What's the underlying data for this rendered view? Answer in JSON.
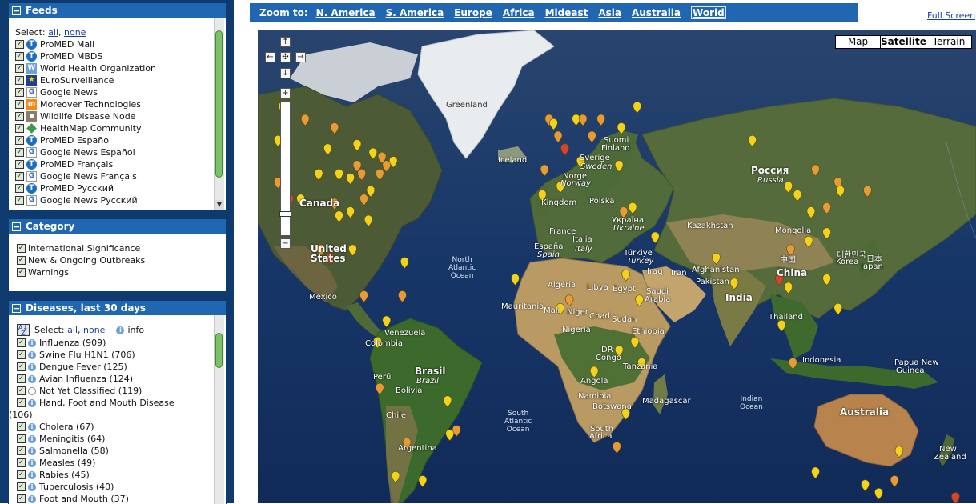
{
  "feeds_panel": {
    "title": "Feeds",
    "select_label": "Select:",
    "select_all": "all",
    "select_none": "none",
    "items": [
      {
        "label": "ProMED Mail",
        "icon": "promed-icon"
      },
      {
        "label": "ProMED MBDS",
        "icon": "promed-icon"
      },
      {
        "label": "World Health Organization",
        "icon": "who-icon"
      },
      {
        "label": "EuroSurveillance",
        "icon": "eurosurveillance-icon"
      },
      {
        "label": "Google News",
        "icon": "google-icon"
      },
      {
        "label": "Moreover Technologies",
        "icon": "moreover-icon"
      },
      {
        "label": "Wildlife Disease Node",
        "icon": "wildlife-icon"
      },
      {
        "label": "HealthMap Community",
        "icon": "healthmap-icon"
      },
      {
        "label": "ProMED Español",
        "icon": "promed-icon"
      },
      {
        "label": "Google News Español",
        "icon": "google-icon"
      },
      {
        "label": "ProMED Français",
        "icon": "promed-icon"
      },
      {
        "label": "Google News Français",
        "icon": "google-icon"
      },
      {
        "label": "ProMED Русский",
        "icon": "promed-icon"
      },
      {
        "label": "Google News Русский",
        "icon": "google-icon"
      }
    ]
  },
  "category_panel": {
    "title": "Category",
    "items": [
      "International Significance",
      "New & Ongoing Outbreaks",
      "Warnings"
    ]
  },
  "diseases_panel": {
    "title": "Diseases, last 30 days",
    "select_label": "Select:",
    "select_all": "all",
    "select_none": "none",
    "info_label": "info",
    "items": [
      {
        "label": "Influenza (909)"
      },
      {
        "label": "Swine Flu H1N1 (706)"
      },
      {
        "label": "Dengue Fever (125)"
      },
      {
        "label": "Avian Influenza (124)"
      },
      {
        "label": "Not Yet Classified (119)",
        "empty_info": true
      },
      {
        "label": "Hand, Foot and Mouth Disease",
        "wrap": "(106)"
      },
      {
        "label": "Cholera (67)"
      },
      {
        "label": "Meningitis (64)"
      },
      {
        "label": "Salmonella (58)"
      },
      {
        "label": "Measles (49)"
      },
      {
        "label": "Rabies (45)"
      },
      {
        "label": "Tuberculosis (40)"
      },
      {
        "label": "Foot and Mouth (37)"
      }
    ]
  },
  "zoombar": {
    "label": "Zoom to:",
    "links": [
      "N. America",
      "S. America",
      "Europe",
      "Africa",
      "Mideast",
      "Asia",
      "Australia",
      "World"
    ],
    "active": "World"
  },
  "fullscreen_label": "Full Screen",
  "map_types": [
    "Map",
    "Satellite",
    "Terrain"
  ],
  "map_type_active": "Satellite",
  "map_controls": {
    "up": "↑",
    "left": "←",
    "center": "✣",
    "right": "→",
    "down": "↓",
    "zoom_in": "+",
    "zoom_out": "−"
  },
  "colors": {
    "header_blue": "#2166b1",
    "sidebar_navy": "#0e3a6d",
    "ocean": "#173668",
    "marker_yellow": "#f2d21a",
    "marker_orange": "#e79b37",
    "marker_red": "#d9432c"
  },
  "map_labels": {
    "greenland": "Greenland",
    "iceland": "Iceland",
    "suomi": "Suomi",
    "finland": "Finland",
    "sverige": "Sverige",
    "sweden": "Sweden",
    "norge": "Norge",
    "norway": "Norway",
    "russia_native": "Россия",
    "russia": "Russia",
    "canada": "Canada",
    "united": "United",
    "states": "States",
    "mexico": "México",
    "kingdom": "Kingdom",
    "polska": "Polska",
    "ukraina": "Україна",
    "ukraine": "Ukraine",
    "france": "France",
    "espana": "España",
    "spain": "Spain",
    "italia": "Italia",
    "italy": "Italy",
    "turkiye": "Türkiye",
    "turkey": "Turkey",
    "iraq": "Iraq",
    "iran": "Iran",
    "kazakhstan": "Kazakhstan",
    "mongolia": "Mongolia",
    "afghanistan": "Afghanistan",
    "pakistan": "Pakistan",
    "korea_native": "대한민국",
    "korea": "Korea",
    "japan_native": "日本",
    "japan": "Japan",
    "china_native": "中国",
    "china": "China",
    "india": "India",
    "thailand": "Thailand",
    "indonesia": "Indonesia",
    "papua": "Papua New",
    "guinea": "Guinea",
    "australia": "Australia",
    "new": "New",
    "zealand": "Zealand",
    "algeria": "Algeria",
    "libya": "Libya",
    "egypt": "Egypt",
    "saudi": "Saudi",
    "arabia": "Arabia",
    "mauritania": "Mauritania",
    "mali": "Mali",
    "niger": "Niger",
    "chad": "Chad",
    "sudan": "Sudan",
    "nigeria": "Nigeria",
    "ethiopia": "Ethiopia",
    "dr": "DR",
    "congo": "Congo",
    "tanzania": "Tanzania",
    "angola": "Angola",
    "namibia": "Namibia",
    "botswana": "Botswana",
    "south": "South",
    "africa": "Africa",
    "madagascar": "Madagascar",
    "venezuela": "Venezuela",
    "colombia": "Colombia",
    "peru": "Perú",
    "brasil": "Brasil",
    "brazil": "Brazil",
    "bolivia": "Bolivia",
    "chile": "Chile",
    "argentina": "Argentina",
    "north_atlantic": "North\nAtlantic\nOcean",
    "south_atlantic": "South\nAtlantic\nOcean",
    "indian_ocean": "Indian\nOcean"
  },
  "markers": [
    {
      "lon": -120,
      "lat": 55,
      "c": "y"
    },
    {
      "lon": -110,
      "lat": 52,
      "c": "o"
    },
    {
      "lon": -97,
      "lat": 50,
      "c": "o"
    },
    {
      "lon": -87,
      "lat": 46,
      "c": "y"
    },
    {
      "lon": -80,
      "lat": 44,
      "c": "y"
    },
    {
      "lon": -76,
      "lat": 43,
      "c": "o"
    },
    {
      "lon": -74,
      "lat": 41,
      "c": "o"
    },
    {
      "lon": -71,
      "lat": 42,
      "c": "y"
    },
    {
      "lon": -77,
      "lat": 39,
      "c": "o"
    },
    {
      "lon": -81,
      "lat": 35,
      "c": "y"
    },
    {
      "lon": -84,
      "lat": 33,
      "c": "o"
    },
    {
      "lon": -87,
      "lat": 41,
      "c": "o"
    },
    {
      "lon": -90,
      "lat": 38,
      "c": "y"
    },
    {
      "lon": -95,
      "lat": 39,
      "c": "y"
    },
    {
      "lon": -97,
      "lat": 32,
      "c": "o"
    },
    {
      "lon": -95,
      "lat": 29,
      "c": "y"
    },
    {
      "lon": -104,
      "lat": 39,
      "c": "y"
    },
    {
      "lon": -112,
      "lat": 33,
      "c": "y"
    },
    {
      "lon": -118,
      "lat": 34,
      "c": "o"
    },
    {
      "lon": -122,
      "lat": 37,
      "c": "o"
    },
    {
      "lon": -122,
      "lat": 47,
      "c": "y"
    },
    {
      "lon": -117,
      "lat": 33,
      "c": "r"
    },
    {
      "lon": -82,
      "lat": 28,
      "c": "y"
    },
    {
      "lon": -90,
      "lat": 30,
      "c": "y"
    },
    {
      "lon": -85,
      "lat": 39,
      "c": "o"
    },
    {
      "lon": -100,
      "lat": 45,
      "c": "y"
    },
    {
      "lon": -99,
      "lat": 19,
      "c": "r"
    },
    {
      "lon": -103,
      "lat": 21,
      "c": "o"
    },
    {
      "lon": -89,
      "lat": 21,
      "c": "y"
    },
    {
      "lon": -84,
      "lat": 10,
      "c": "o"
    },
    {
      "lon": -66,
      "lat": 18,
      "c": "y"
    },
    {
      "lon": -67,
      "lat": 10,
      "c": "o"
    },
    {
      "lon": -74,
      "lat": 4,
      "c": "y"
    },
    {
      "lon": -78,
      "lat": -1,
      "c": "y"
    },
    {
      "lon": -77,
      "lat": -12,
      "c": "o"
    },
    {
      "lon": -47,
      "lat": -15,
      "c": "y"
    },
    {
      "lon": -43,
      "lat": -22,
      "c": "o"
    },
    {
      "lon": -46,
      "lat": -23,
      "c": "y"
    },
    {
      "lon": -58,
      "lat": -34,
      "c": "y"
    },
    {
      "lon": -70,
      "lat": -33,
      "c": "y"
    },
    {
      "lon": -65,
      "lat": -25,
      "c": "o"
    },
    {
      "lon": -2,
      "lat": 52,
      "c": "o"
    },
    {
      "lon": 0,
      "lat": 51,
      "c": "y"
    },
    {
      "lon": 2,
      "lat": 48,
      "c": "o"
    },
    {
      "lon": -4,
      "lat": 40,
      "c": "o"
    },
    {
      "lon": 10,
      "lat": 52,
      "c": "y"
    },
    {
      "lon": 13,
      "lat": 52,
      "c": "o"
    },
    {
      "lon": 12,
      "lat": 42,
      "c": "y"
    },
    {
      "lon": 21,
      "lat": 52,
      "c": "o"
    },
    {
      "lon": 30,
      "lat": 50,
      "c": "y"
    },
    {
      "lon": 37,
      "lat": 55,
      "c": "y"
    },
    {
      "lon": 29,
      "lat": 41,
      "c": "y"
    },
    {
      "lon": 35,
      "lat": 31,
      "c": "y"
    },
    {
      "lon": 31,
      "lat": 30,
      "c": "o"
    },
    {
      "lon": 5,
      "lat": 45,
      "c": "r"
    },
    {
      "lon": 17,
      "lat": 48,
      "c": "o"
    },
    {
      "lon": 3,
      "lat": 36,
      "c": "y"
    },
    {
      "lon": -5,
      "lat": 34,
      "c": "y"
    },
    {
      "lon": -17,
      "lat": 14,
      "c": "y"
    },
    {
      "lon": 3,
      "lat": 7,
      "c": "y"
    },
    {
      "lon": 7,
      "lat": 9,
      "c": "o"
    },
    {
      "lon": 32,
      "lat": 15,
      "c": "y"
    },
    {
      "lon": 38,
      "lat": 9,
      "c": "y"
    },
    {
      "lon": 36,
      "lat": -1,
      "c": "y"
    },
    {
      "lon": 29,
      "lat": -3,
      "c": "y"
    },
    {
      "lon": 39,
      "lat": -6,
      "c": "y"
    },
    {
      "lon": 18,
      "lat": -8,
      "c": "y"
    },
    {
      "lon": 28,
      "lat": -26,
      "c": "o"
    },
    {
      "lon": 32,
      "lat": -18,
      "c": "y"
    },
    {
      "lon": 45,
      "lat": 24,
      "c": "y"
    },
    {
      "lon": 88,
      "lat": 47,
      "c": "y"
    },
    {
      "lon": 104,
      "lat": 36,
      "c": "y"
    },
    {
      "lon": 113,
      "lat": 23,
      "c": "y"
    },
    {
      "lon": 116,
      "lat": 40,
      "c": "o"
    },
    {
      "lon": 121,
      "lat": 31,
      "c": "o"
    },
    {
      "lon": 114,
      "lat": 30,
      "c": "y"
    },
    {
      "lon": 108,
      "lat": 34,
      "c": "y"
    },
    {
      "lon": 126,
      "lat": 37,
      "c": "o"
    },
    {
      "lon": 127,
      "lat": 35,
      "c": "y"
    },
    {
      "lon": 121,
      "lat": 25,
      "c": "y"
    },
    {
      "lon": 139,
      "lat": 35,
      "c": "o"
    },
    {
      "lon": 100,
      "lat": 14,
      "c": "r"
    },
    {
      "lon": 105,
      "lat": 21,
      "c": "o"
    },
    {
      "lon": 101,
      "lat": 3,
      "c": "y"
    },
    {
      "lon": 106,
      "lat": -6,
      "c": "o"
    },
    {
      "lon": 121,
      "lat": 14,
      "c": "y"
    },
    {
      "lon": 104,
      "lat": 12,
      "c": "y"
    },
    {
      "lon": 80,
      "lat": 13,
      "c": "y"
    },
    {
      "lon": 72,
      "lat": 19,
      "c": "y"
    },
    {
      "lon": 126,
      "lat": 7,
      "c": "y"
    },
    {
      "lon": 144,
      "lat": -37,
      "c": "y"
    },
    {
      "lon": 151,
      "lat": -34,
      "c": "o"
    },
    {
      "lon": 153,
      "lat": -27,
      "c": "y"
    },
    {
      "lon": 116,
      "lat": -32,
      "c": "y"
    },
    {
      "lon": 138,
      "lat": -35,
      "c": "y"
    },
    {
      "lon": 175,
      "lat": -41,
      "c": "o"
    },
    {
      "lon": 178,
      "lat": -38,
      "c": "r"
    }
  ]
}
